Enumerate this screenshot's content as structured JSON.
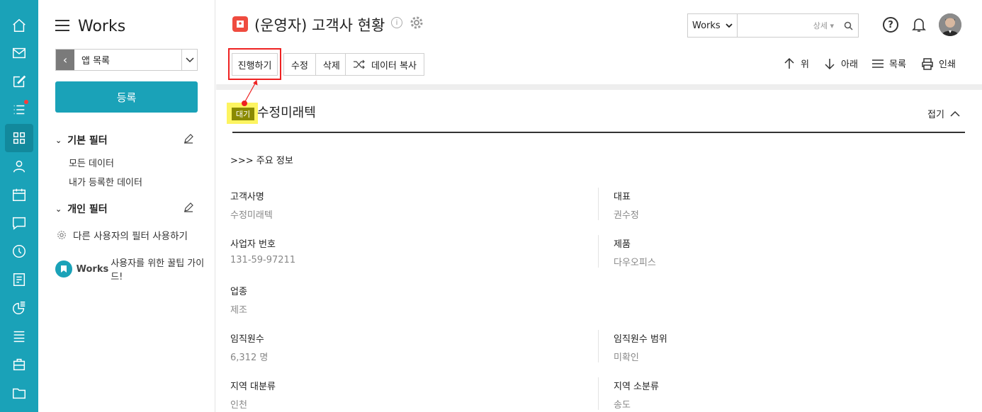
{
  "sidebar": {
    "app_title": "Works",
    "app_select_label": "앱 목록",
    "register_label": "등록",
    "basic_filter_label": "기본 필터",
    "basic_filter_items": [
      "모든 데이터",
      "내가 등록한 데이터"
    ],
    "personal_filter_label": "개인 필터",
    "other_user_filter_label": "다른 사용자의 필터 사용하기",
    "guide": {
      "brand": "Works",
      "text": "사용자를 위한 꿀팁 가이드!"
    }
  },
  "header": {
    "title": "(운영자) 고객사 현황",
    "search": {
      "scope": "Works",
      "detail_label": "상세"
    }
  },
  "toolbar": {
    "progress_label": "진행하기",
    "edit_label": "수정",
    "delete_label": "삭제",
    "copy_label": "데이터 복사",
    "up_label": "위",
    "down_label": "아래",
    "list_label": "목록",
    "print_label": "인쇄"
  },
  "record": {
    "status": "대기",
    "name": "수정미래텍",
    "collapse_label": "접기",
    "section_label": ">>> 주요 정보",
    "fields": {
      "customer_name": {
        "label": "고객사명",
        "value": "수정미래텍"
      },
      "ceo": {
        "label": "대표",
        "value": "권수정"
      },
      "biz_no": {
        "label": "사업자 번호",
        "value": "131-59-97211"
      },
      "product": {
        "label": "제품",
        "value": "다우오피스"
      },
      "industry": {
        "label": "업종",
        "value": "제조"
      },
      "employees": {
        "label": "임직원수",
        "value": "6,312 명"
      },
      "employee_range": {
        "label": "임직원수 범위",
        "value": "미확인"
      },
      "region_major": {
        "label": "지역 대분류",
        "value": "인천"
      },
      "region_minor": {
        "label": "지역 소분류",
        "value": "송도"
      }
    }
  },
  "colors": {
    "accent": "#1aa2b8",
    "highlight": "#fdf460",
    "annotation": "#e22222"
  }
}
